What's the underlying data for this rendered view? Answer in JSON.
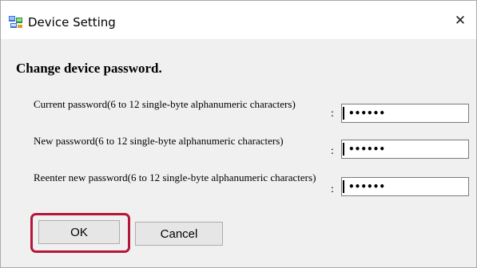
{
  "window": {
    "title": "Device Setting",
    "app_icon": "device-setting-icon",
    "close_icon": "close-icon",
    "close_glyph": "✕"
  },
  "form": {
    "heading": "Change device password.",
    "rows": [
      {
        "label": "Current password(6 to 12 single-byte alphanumeric characters)",
        "colon": ":",
        "value": "••••••"
      },
      {
        "label": "New password(6 to 12 single-byte alphanumeric characters)",
        "colon": ":",
        "value": "••••••"
      },
      {
        "label": "Reenter new password(6 to 12 single-byte alphanumeric characters)",
        "colon": ":",
        "value": "••••••"
      }
    ]
  },
  "buttons": {
    "ok": "OK",
    "cancel": "Cancel"
  },
  "colors": {
    "highlight": "#b3173a",
    "background": "#f0f0f0"
  }
}
